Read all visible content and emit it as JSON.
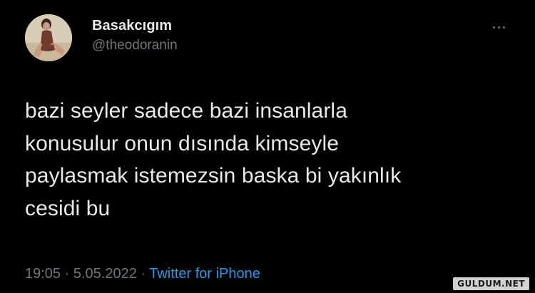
{
  "user": {
    "display_name": "Basakcıgım",
    "handle": "@theodoranin",
    "avatar_icon": "profile-photo"
  },
  "more_icon": "more-horizontal-icon",
  "tweet": {
    "text": "bazi seyler sadece bazi insanlarla\nkonusulur onun dısında kimseyle\npaylasmak istemezsin baska bi yakınlık\ncesidi bu",
    "time": "19:05",
    "separator1": " · ",
    "date": "5.05.2022",
    "separator2": " · ",
    "source": "Twitter for iPhone"
  },
  "watermark": "GULDUM.NET",
  "colors": {
    "background": "#000000",
    "primary_text": "#e7e9ea",
    "secondary_text": "#71767b",
    "link": "#1d9bf0"
  }
}
